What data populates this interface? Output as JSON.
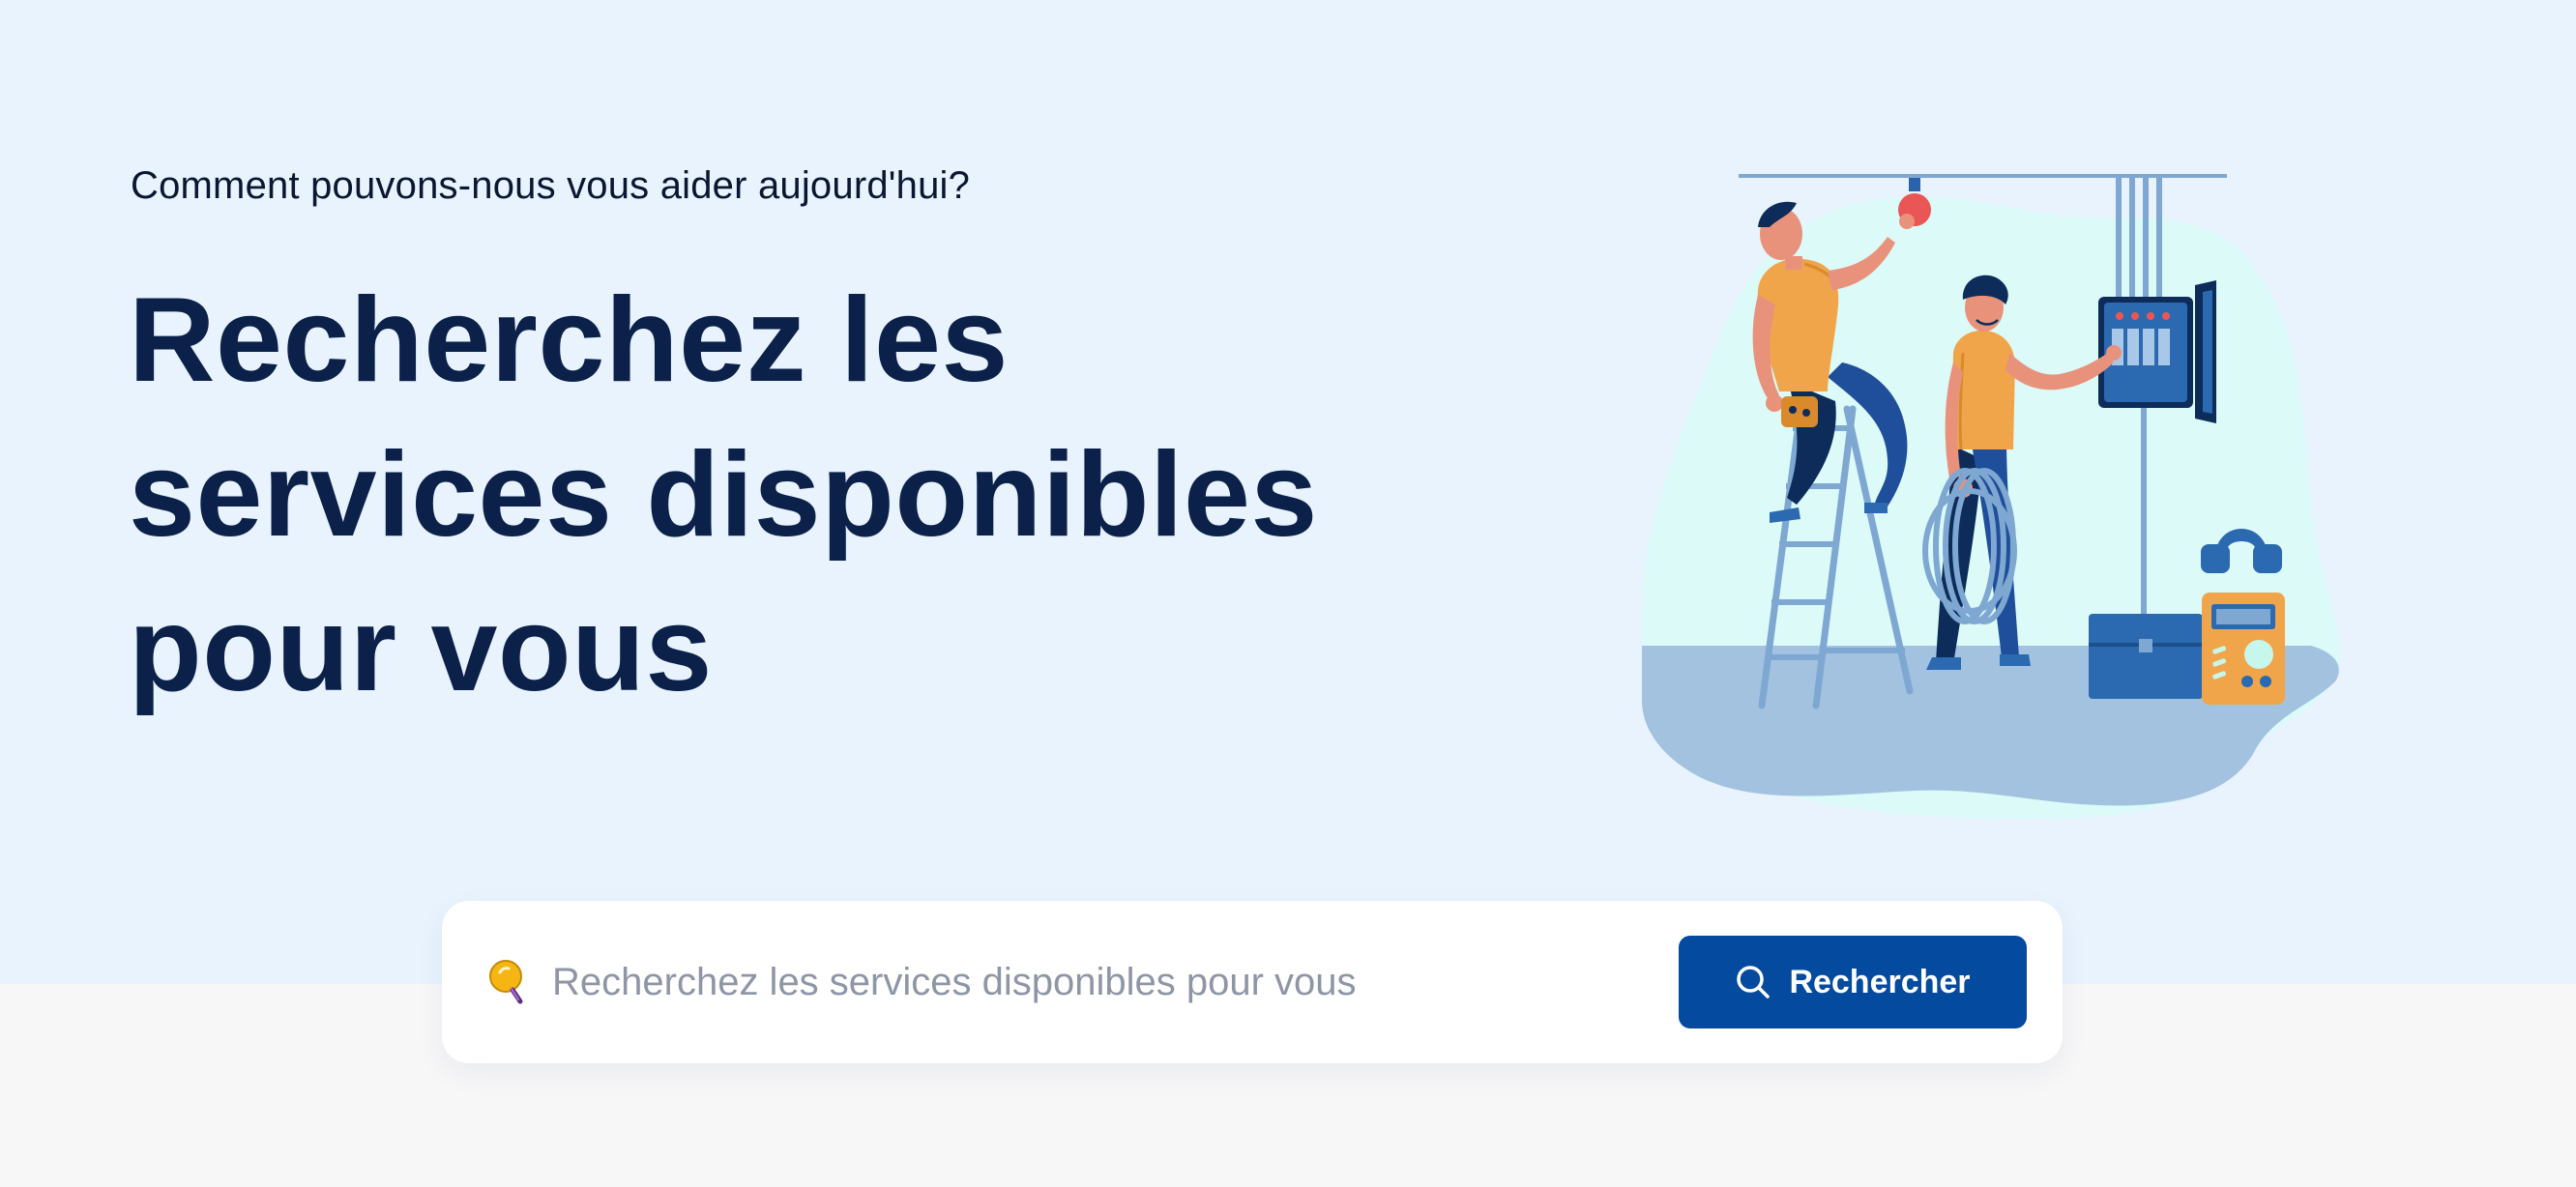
{
  "hero": {
    "kicker": "Comment pouvons-nous vous aider aujourd'hui?",
    "headline": "Recherchez les services disponibles pour vous",
    "illustration_icon": "electricians-illustration"
  },
  "search": {
    "placeholder": "Recherchez les services disponibles pour vous",
    "value": "",
    "leading_icon": "lightbulb-icon",
    "button_label": "Rechercher",
    "button_icon": "search-icon"
  },
  "colors": {
    "hero_background": "#e8f3fe",
    "page_background": "#f7f7f8",
    "headline": "#0b2149",
    "button": "#044a9e",
    "placeholder": "#8e96a6"
  }
}
